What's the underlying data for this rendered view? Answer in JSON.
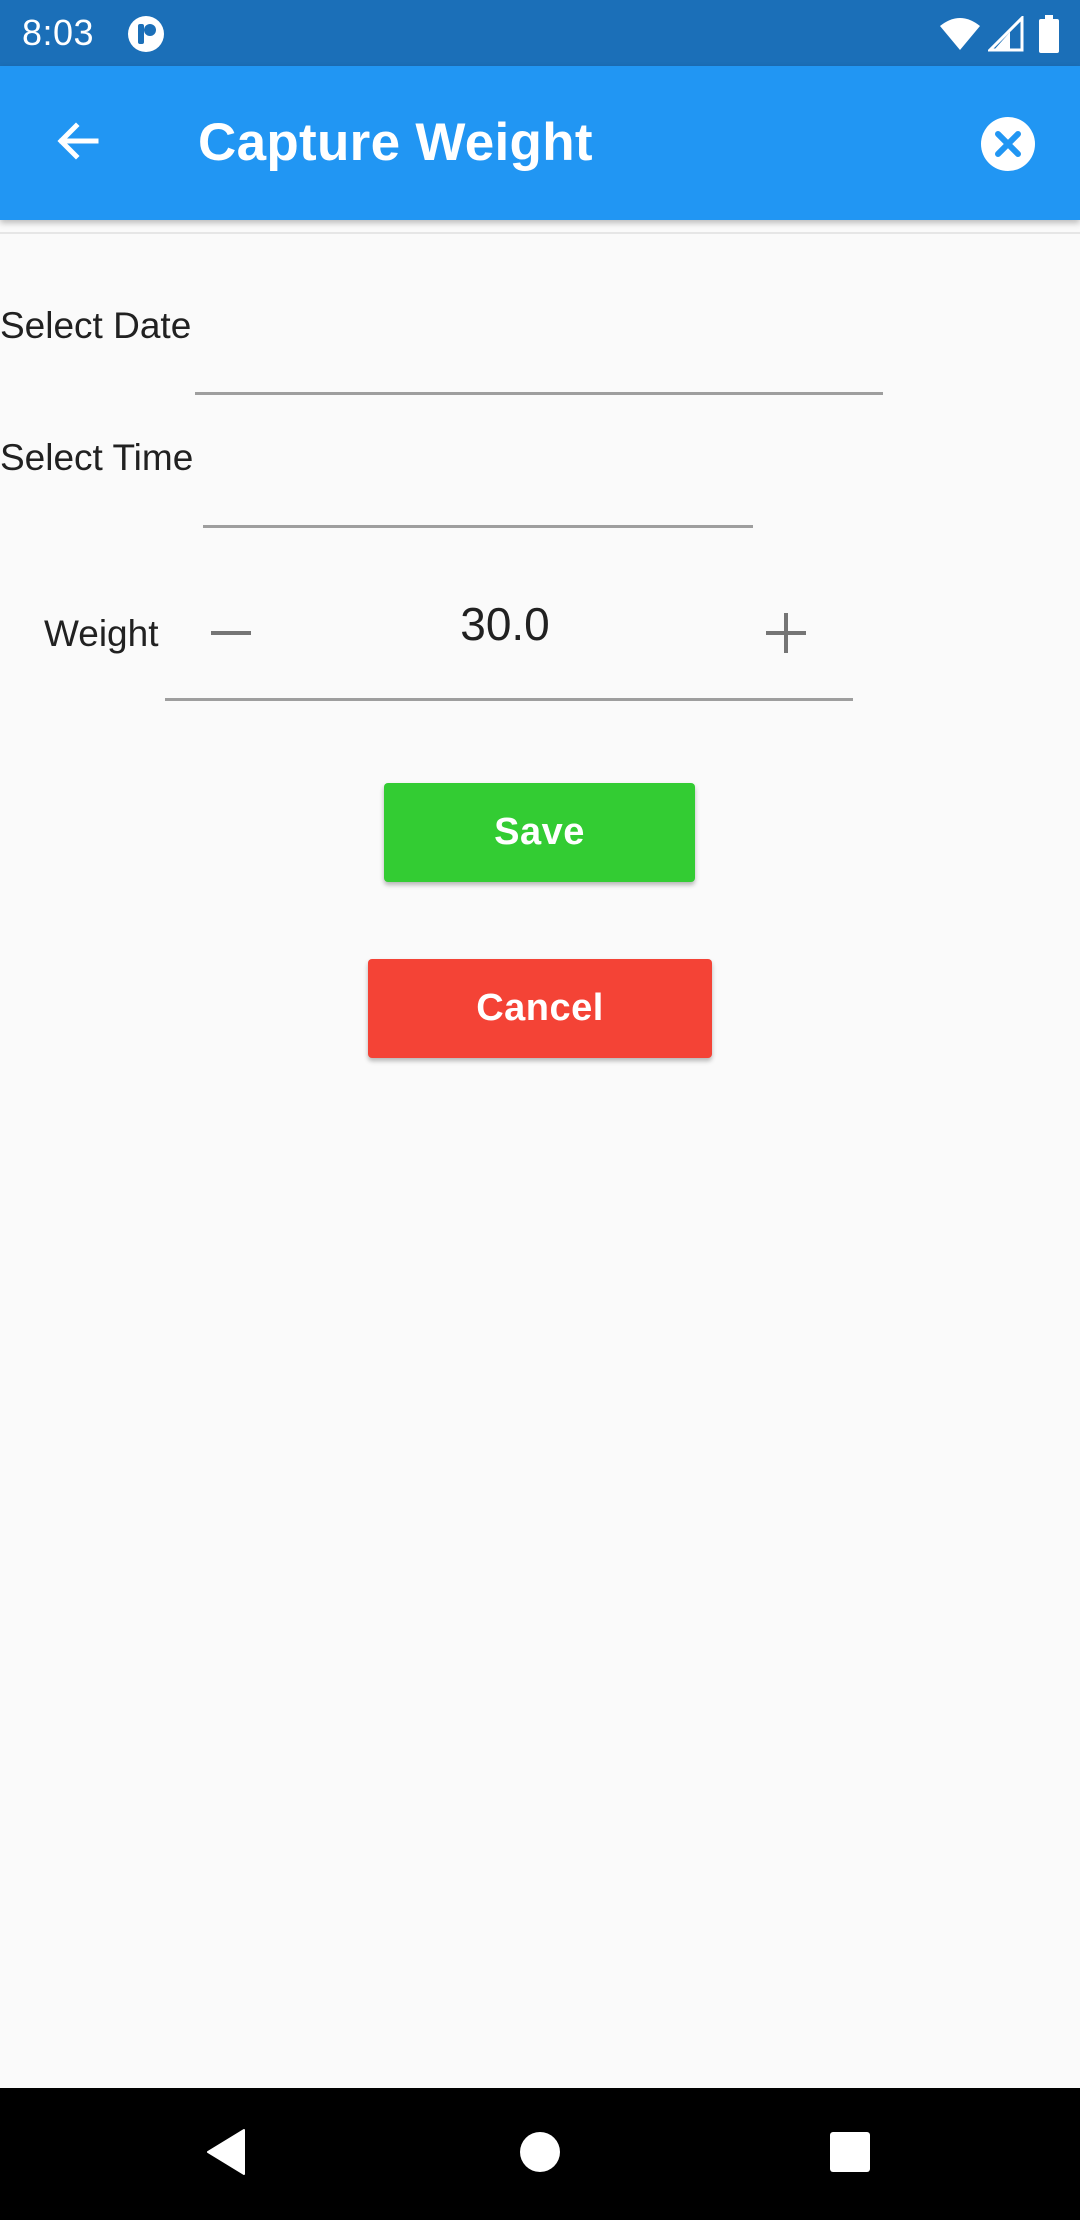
{
  "status_bar": {
    "time": "8:03"
  },
  "app_bar": {
    "title": "Capture Weight",
    "back_icon": "arrow-back-icon",
    "close_icon": "close-circle-icon"
  },
  "form": {
    "date_label": "Select Date",
    "date_value": "",
    "time_label": "Select Time",
    "time_value": "",
    "weight_label": "Weight",
    "weight_value": "30.0",
    "decrement_icon": "minus-icon",
    "increment_icon": "plus-icon"
  },
  "actions": {
    "save_label": "Save",
    "cancel_label": "Cancel"
  },
  "colors": {
    "status_bar": "#1b6fb8",
    "app_bar": "#2196f3",
    "save_button": "#33cc33",
    "cancel_button": "#f44336",
    "background": "#fafafa"
  },
  "nav_bar": {
    "back_icon": "nav-back-triangle-icon",
    "home_icon": "nav-home-circle-icon",
    "recents_icon": "nav-recents-square-icon"
  }
}
